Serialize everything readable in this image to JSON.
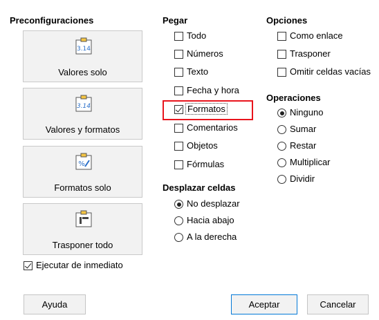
{
  "presets": {
    "header": "Preconfiguraciones",
    "items": [
      {
        "label": "Valores solo",
        "icon": "paste-values-icon",
        "icon_text": "3.14"
      },
      {
        "label": "Valores y formatos",
        "icon": "paste-values-formats-icon",
        "icon_text": "3.14"
      },
      {
        "label": "Formatos solo",
        "icon": "paste-formats-icon",
        "icon_text": "%"
      },
      {
        "label": "Trasponer todo",
        "icon": "paste-transpose-icon",
        "icon_text": ""
      }
    ],
    "run_immediately": {
      "label": "Ejecutar de inmediato",
      "checked": true
    }
  },
  "paste": {
    "header": "Pegar",
    "options": [
      {
        "label": "Todo",
        "checked": false
      },
      {
        "label": "Números",
        "checked": false
      },
      {
        "label": "Texto",
        "checked": false
      },
      {
        "label": "Fecha y hora",
        "checked": false
      },
      {
        "label": "Formatos",
        "checked": true,
        "highlighted": true
      },
      {
        "label": "Comentarios",
        "checked": false
      },
      {
        "label": "Objetos",
        "checked": false
      },
      {
        "label": "Fórmulas",
        "checked": false
      }
    ]
  },
  "shift": {
    "header": "Desplazar celdas",
    "options": [
      {
        "label": "No desplazar",
        "selected": true
      },
      {
        "label": "Hacia abajo",
        "selected": false
      },
      {
        "label": "A la derecha",
        "selected": false
      }
    ]
  },
  "options": {
    "header": "Opciones",
    "items": [
      {
        "label": "Como enlace",
        "checked": false
      },
      {
        "label": "Trasponer",
        "checked": false
      },
      {
        "label": "Omitir celdas vacías",
        "checked": false
      }
    ]
  },
  "operations": {
    "header": "Operaciones",
    "items": [
      {
        "label": "Ninguno",
        "selected": true
      },
      {
        "label": "Sumar",
        "selected": false
      },
      {
        "label": "Restar",
        "selected": false
      },
      {
        "label": "Multiplicar",
        "selected": false
      },
      {
        "label": "Dividir",
        "selected": false
      }
    ]
  },
  "buttons": {
    "help": "Ayuda",
    "ok": "Aceptar",
    "cancel": "Cancelar"
  },
  "colors": {
    "highlight": "#e8141c",
    "default_button_border": "#0078d7",
    "icon_blue": "#2a6fc9",
    "icon_yellow": "#f5c542"
  }
}
